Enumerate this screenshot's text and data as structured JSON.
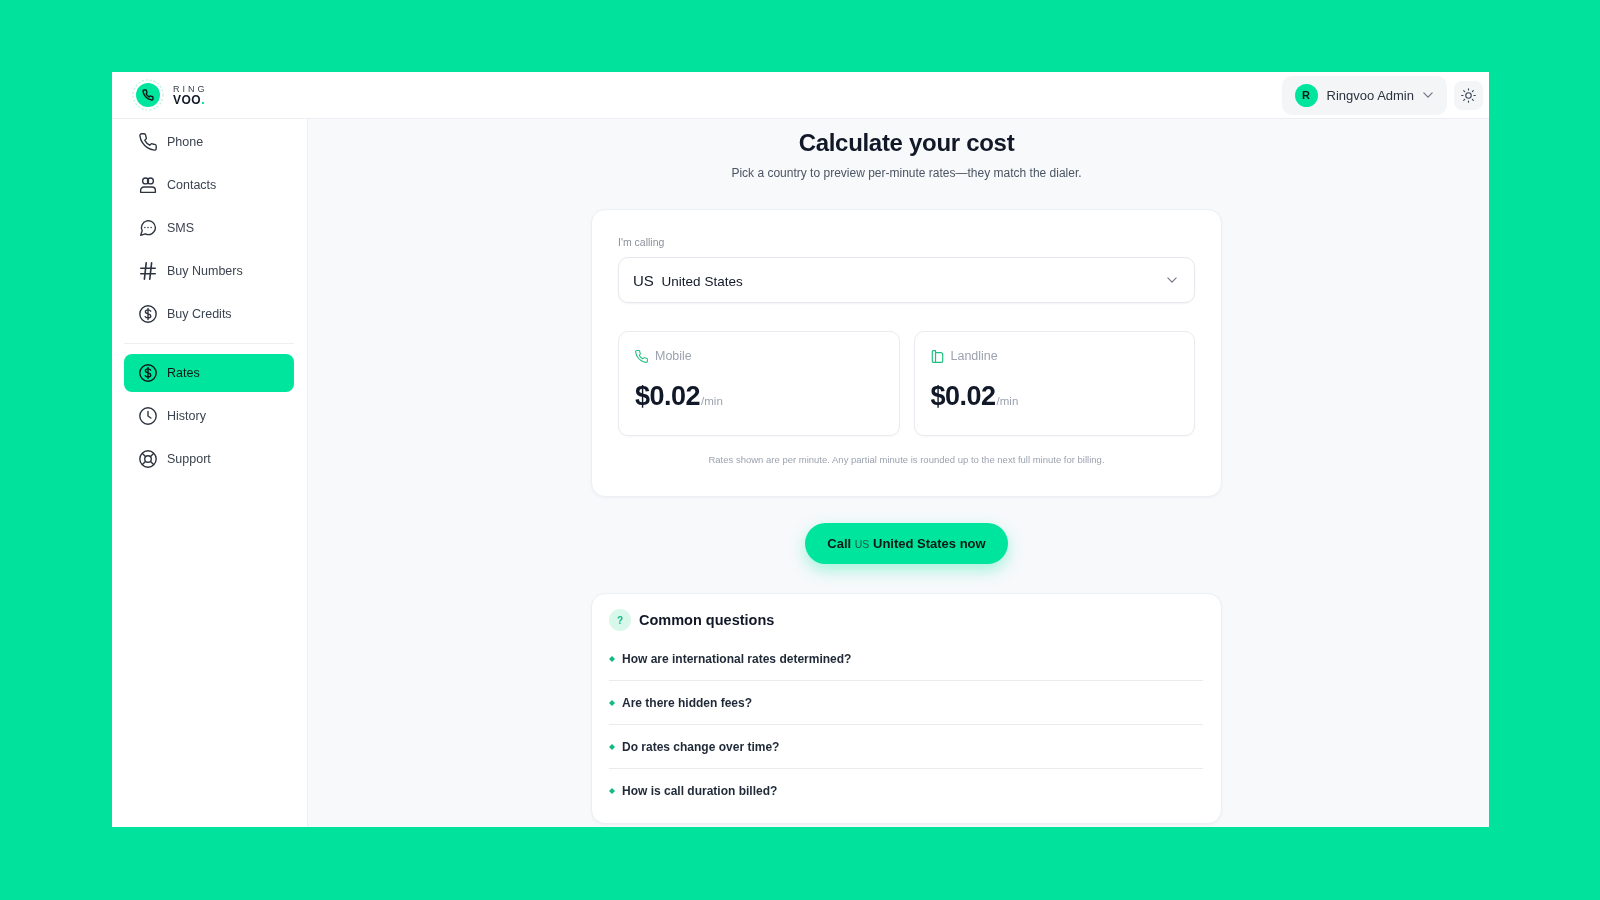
{
  "brand": {
    "top": "RING",
    "name": "VOO",
    "mark": "."
  },
  "user_menu": {
    "initial": "R",
    "name": "Ringvoo Admin"
  },
  "sidebar": {
    "groups": [
      {
        "items": [
          {
            "label": "Phone",
            "selected": false
          },
          {
            "label": "Contacts",
            "selected": false
          },
          {
            "label": "SMS",
            "selected": false
          },
          {
            "label": "Buy Numbers",
            "selected": false
          },
          {
            "label": "Buy Credits",
            "selected": false
          }
        ]
      },
      {
        "items": [
          {
            "label": "Rates",
            "selected": true
          },
          {
            "label": "History",
            "selected": false
          },
          {
            "label": "Support",
            "selected": false
          }
        ]
      }
    ]
  },
  "page": {
    "title": "Calculate your cost",
    "subtitle": "Pick a country to preview per-minute rates—they match the dialer."
  },
  "calculator": {
    "field_label": "I'm calling",
    "country_code": "US",
    "country": "United States",
    "rates": [
      {
        "type": "Mobile",
        "price": "$0.02",
        "unit": "/min"
      },
      {
        "type": "Landline",
        "price": "$0.02",
        "unit": "/min"
      }
    ],
    "note": "Rates shown are per minute. Any partial minute is rounded up to the next full minute for billing."
  },
  "cta": {
    "prefix": "Call",
    "code": "US",
    "suffix": "United States now"
  },
  "faq": {
    "icon": "?",
    "title": "Common questions",
    "items": [
      "How are international rates determined?",
      "Are there hidden fees?",
      "Do rates change over time?",
      "How is call duration billed?"
    ]
  }
}
